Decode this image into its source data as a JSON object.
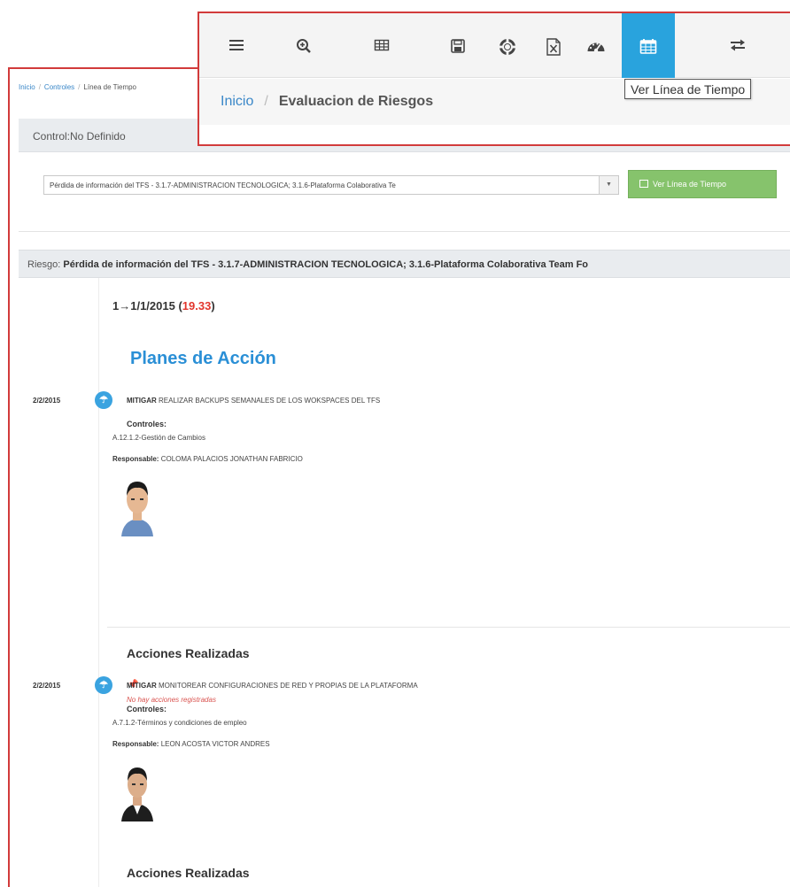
{
  "breadcrumb": {
    "home": "Inicio",
    "section": "Controles",
    "current": "Línea de Tiempo"
  },
  "control_header": "Control:No Definido",
  "risk_select": {
    "selected": "Pérdida de información del TFS - 3.1.7-ADMINISTRACION TECNOLOGICA; 3.1.6-Plataforma Colaborativa Te"
  },
  "timeline_button_label": "Ver Línea de Tiempo",
  "risk_header": {
    "label": "Riesgo:",
    "value": "Pérdida de información del TFS - 3.1.7-ADMINISTRACION TECNOLOGICA; 3.1.6-Plataforma Colaborativa Team Fo"
  },
  "timeline_entry": {
    "range": "1→1/1/2015",
    "score": "19.33"
  },
  "plans_title": "Planes de Acción",
  "plans": [
    {
      "date": "2/2/2015",
      "type": "MITIGAR",
      "description": "REALIZAR BACKUPS SEMANALES DE LOS WOKSPACES DEL TFS",
      "controls_label": "Controles:",
      "control": "A.12.1.2-Gestión de Cambios",
      "responsible_label": "Responsable:",
      "responsible": "COLOMA PALACIOS JONATHAN FABRICIO",
      "actions_title": "Acciones Realizadas",
      "no_actions": "No hay acciones registradas"
    },
    {
      "date": "2/2/2015",
      "type": "MITIGAR",
      "description": "MONITOREAR CONFIGURACIONES DE RED Y PROPIAS DE LA PLATAFORMA",
      "controls_label": "Controles:",
      "control": "A.7.1.2-Términos y condiciones de empleo",
      "responsible_label": "Responsable:",
      "responsible": "LEON ACOSTA VICTOR ANDRES",
      "actions_title": "Acciones Realizadas"
    }
  ],
  "zoom_overlay": {
    "toolbar_icons": [
      "menu-icon",
      "zoom-in-icon",
      "table-icon",
      "save-icon",
      "support-icon",
      "excel-icon",
      "dashboard-icon",
      "calendar-icon",
      "swap-icon"
    ],
    "active_icon": "calendar-icon",
    "breadcrumb_home": "Inicio",
    "breadcrumb_current": "Evaluacion de Riesgos",
    "tooltip": "Ver Línea de Tiempo"
  },
  "colors": {
    "accent_blue": "#29a3dd",
    "heading_blue": "#2a8fd6",
    "success_green": "#86c36c",
    "score_red": "#e2352c",
    "highlight_border": "#d23b3b"
  }
}
